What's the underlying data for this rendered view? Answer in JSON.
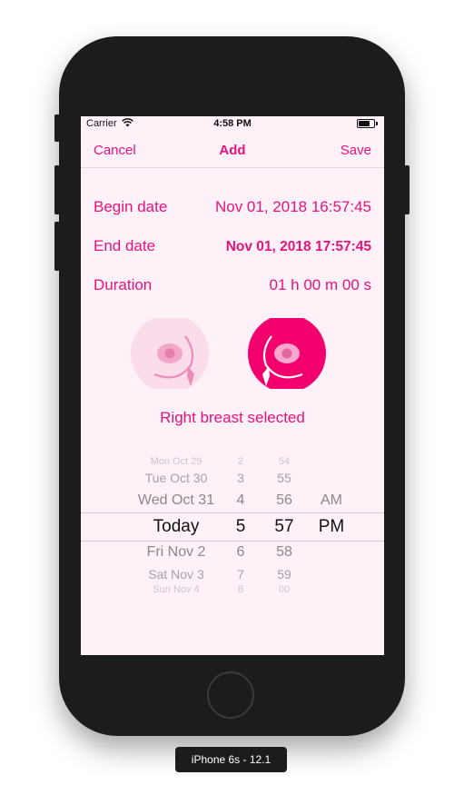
{
  "status_bar": {
    "carrier": "Carrier",
    "time": "4:58 PM"
  },
  "nav": {
    "cancel": "Cancel",
    "title": "Add",
    "save": "Save"
  },
  "fields": {
    "begin_label": "Begin date",
    "begin_value": "Nov 01, 2018 16:57:45",
    "end_label": "End date",
    "end_value": "Nov 01, 2018 17:57:45",
    "duration_label": "Duration",
    "duration_value": "01 h 00 m 00 s"
  },
  "breast": {
    "left_selected": false,
    "right_selected": true,
    "selection_text": "Right breast selected"
  },
  "picker": {
    "dates": [
      "Mon Oct 29",
      "Tue Oct 30",
      "Wed Oct 31",
      "Today",
      "Fri Nov 2",
      "Sat Nov 3",
      "Sun Nov 4"
    ],
    "hours": [
      "2",
      "3",
      "4",
      "5",
      "6",
      "7",
      "8"
    ],
    "minutes": [
      "54",
      "55",
      "56",
      "57",
      "58",
      "59",
      "00"
    ],
    "ampm": [
      "",
      "",
      "AM",
      "PM",
      "",
      "",
      ""
    ]
  },
  "device_label": "iPhone 6s - 12.1",
  "colors": {
    "accent": "#e5147d",
    "accent_light": "#fbdcea",
    "background": "#fef1f7"
  }
}
